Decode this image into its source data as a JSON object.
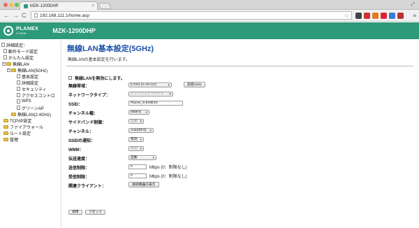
{
  "browser": {
    "tab_title": "MZK-1200DHP",
    "tab_close": "×",
    "url": "192.168.111.1/home.asp",
    "back": "←",
    "forward": "→",
    "reload": "C",
    "star": "☆",
    "menu": "≡"
  },
  "header": {
    "brand_top": "PLANEX",
    "brand_bottom": "COMM.",
    "model": "MZK-1200DHP"
  },
  "sidebar": {
    "items": [
      {
        "label": "詳細設定："
      },
      {
        "label": "動作モード設定"
      },
      {
        "label": "かんたん設定"
      },
      {
        "label": "無線LAN"
      },
      {
        "label": "無線LAN(5GHz)"
      },
      {
        "label": "基本設定"
      },
      {
        "label": "詳細設定"
      },
      {
        "label": "セキュリティ"
      },
      {
        "label": "アクセスコントロ"
      },
      {
        "label": "WPS"
      },
      {
        "label": "グリーンAP"
      },
      {
        "label": "無線LAN(2.4GHz)"
      },
      {
        "label": "TCP/IP設定"
      },
      {
        "label": "ファイアウォール"
      },
      {
        "label": "ルート設定"
      },
      {
        "label": "管理"
      }
    ]
  },
  "main": {
    "title": "無線LAN基本設定(5GHz)",
    "description": "無線LANの基本設定を行います。",
    "disable_wireless_label": "無線LANを無効にします。",
    "fields": {
      "band_label": "無線帯域：",
      "band_value": "5 GHz (A+N+AC)",
      "virtual_ssid_button": "仮想SSID",
      "network_type_label": "ネットワークタイプ：",
      "network_type_value": "インフラストラクチャ",
      "ssid_label": "SSID：",
      "ssid_value": "Planex_5-E26E19",
      "channel_width_label": "チャンネル幅：",
      "channel_width_value": "80MHz",
      "sideband_label": "サイドバンド制御：",
      "sideband_value": "自動",
      "channel_label": "チャンネル：",
      "channel_value": "Auto(DFS)",
      "ssid_broadcast_label": "SSIDの通知：",
      "ssid_broadcast_value": "有効",
      "wmm_label": "WMM：",
      "wmm_value": "有効",
      "tx_rate_label": "伝送速度：",
      "tx_rate_value": "自動",
      "send_limit_label": "送信制限：",
      "send_limit_value": "0",
      "send_limit_unit": "Mbps (0：制限なし)",
      "recv_limit_label": "受信制限：",
      "recv_limit_value": "0",
      "recv_limit_unit": "Mbps (0：制限なし)",
      "clients_label": "関連クライアント：",
      "clients_button": "接続機器の表示"
    },
    "apply_button": "適用",
    "reset_button": "リセット"
  },
  "colors": {
    "header_green": "#2d9a78",
    "title_blue": "#1a4fa8"
  }
}
